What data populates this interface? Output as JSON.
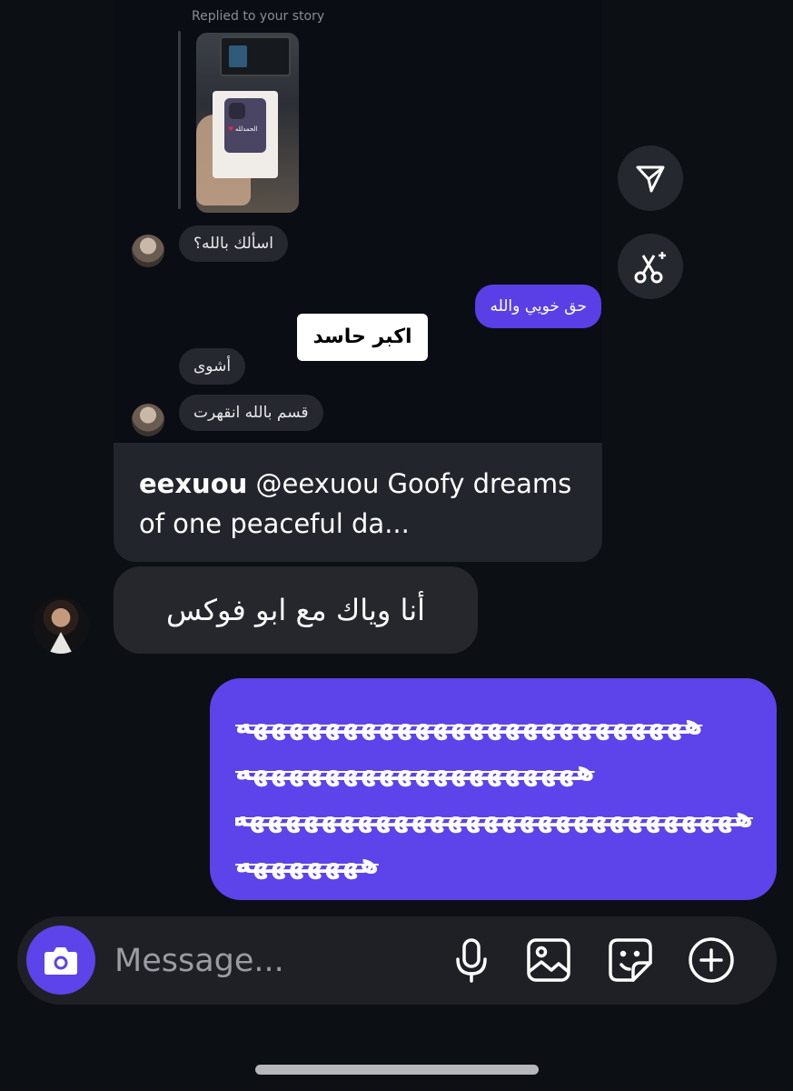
{
  "shared_post": {
    "story_reply_label": "Replied to your story",
    "thumb_text": "الحمدلله",
    "messages": [
      {
        "side": "received",
        "text": "اسألك بالله؟"
      },
      {
        "side": "sent",
        "text": "حق خويي والله"
      },
      {
        "side": "received",
        "text": "أشوى"
      },
      {
        "side": "received",
        "text": "قسم بالله انقهرت"
      }
    ],
    "sticker_text": "اكبر حاسد",
    "caption_user": "eexuou",
    "caption_text": "@eexuou Goofy dreams of one peaceful da..."
  },
  "side_actions": {
    "share_icon": "send-icon",
    "remix_icon": "scissors-sparkle-icon"
  },
  "received_message": {
    "text": "أنا وياك مع ابو فوكس"
  },
  "sent_message": {
    "lines": [
      "هههههههههههههههههههههههههه",
      "هههههههههههههههههههه",
      "ههههههههههههههههههههههههههههه",
      "هههههههه"
    ]
  },
  "composer": {
    "placeholder": "Message...",
    "camera_icon": "camera-icon",
    "mic_icon": "microphone-icon",
    "gallery_icon": "image-icon",
    "sticker_icon": "sticker-icon",
    "more_icon": "plus-circle-icon"
  },
  "colors": {
    "background": "#0c0f14",
    "accent": "#5c43ea",
    "bubble_gray": "#25272d"
  }
}
